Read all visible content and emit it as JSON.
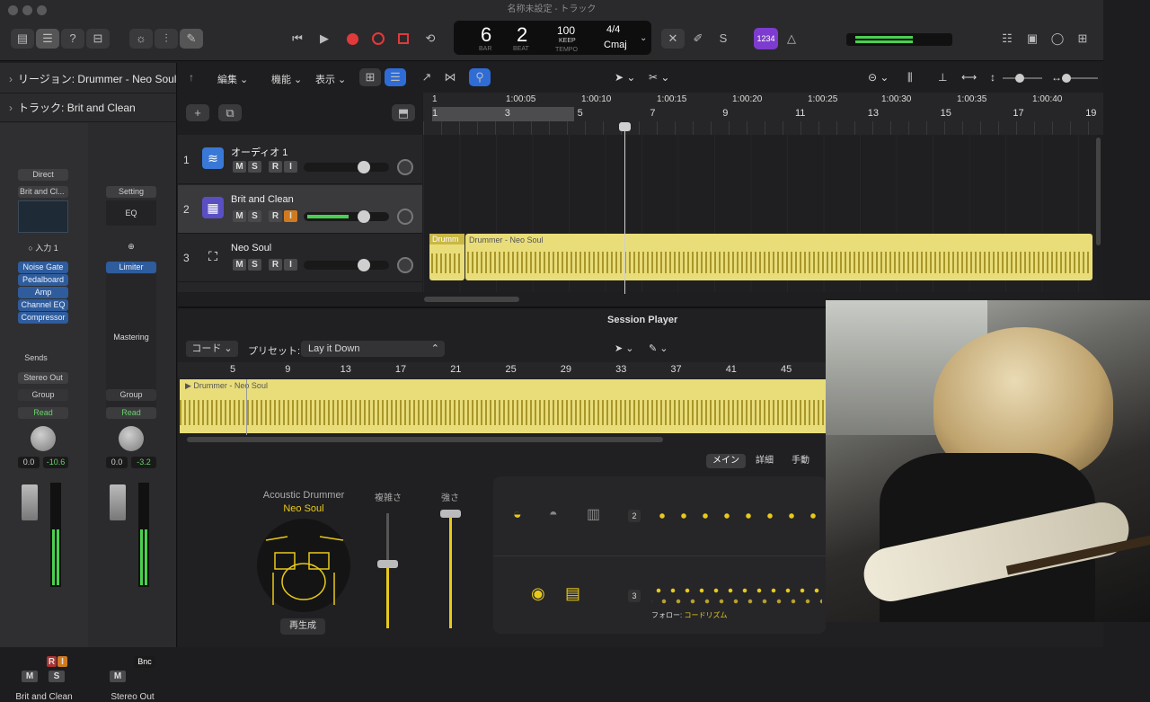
{
  "window": {
    "title": "名称未設定 - トラック"
  },
  "lcd": {
    "bar": "6",
    "beat": "2",
    "bar_label": "BAR",
    "beat_label": "BEAT",
    "tempo": "100",
    "keep": "KEEP",
    "tempo_label": "TEMPO",
    "time_sig": "4/4",
    "key": "Cmaj"
  },
  "toolbar": {
    "count_in_badge": "1234"
  },
  "inspector": {
    "region_row": "リージョン: Drummer - Neo Soul",
    "track_row_prefix": "トラック:",
    "track_row_name": "Brit and Clean",
    "strip1": {
      "top": "Direct",
      "preset": "Brit and Cl...",
      "input": "入力 1",
      "plugins": [
        "Noise Gate",
        "Pedalboard",
        "Amp",
        "Channel EQ",
        "Compressor"
      ],
      "sends": "Sends",
      "output": "Stereo Out",
      "group": "Group",
      "read": "Read",
      "vol": "0.0",
      "peak": "-10.6",
      "r": "R",
      "i": "I",
      "m": "M",
      "s": "S",
      "name": "Brit and Clean"
    },
    "strip2": {
      "setting": "Setting",
      "eq": "EQ",
      "plugins": [
        "Limiter"
      ],
      "mastering": "Mastering",
      "group": "Group",
      "read": "Read",
      "vol": "0.0",
      "peak": "-3.2",
      "bnc": "Bnc",
      "m": "M",
      "name": "Stereo Out"
    }
  },
  "tracks_bar": {
    "edit": "編集",
    "function": "機能",
    "view": "表示"
  },
  "ruler": {
    "times": [
      "1",
      "1:00:05",
      "1:00:10",
      "1:00:15",
      "1:00:20",
      "1:00:25",
      "1:00:30",
      "1:00:35",
      "1:00:40"
    ],
    "bars": [
      "1",
      "3",
      "5",
      "7",
      "9",
      "11",
      "13",
      "15",
      "17",
      "19"
    ]
  },
  "tracks": [
    {
      "num": "1",
      "name": "オーディオ 1",
      "m": "M",
      "s": "S",
      "r": "R",
      "i": "I"
    },
    {
      "num": "2",
      "name": "Brit and Clean",
      "m": "M",
      "s": "S",
      "r": "R",
      "i": "I"
    },
    {
      "num": "3",
      "name": "Neo Soul",
      "m": "M",
      "s": "S",
      "r": "R",
      "i": "I"
    }
  ],
  "regions": {
    "short": "Drumm",
    "main": "Drummer - Neo Soul"
  },
  "editor": {
    "title": "Session Player",
    "chord_menu": "コード",
    "preset_label": "プリセット:",
    "preset_value": "Lay it Down",
    "bars": [
      "5",
      "9",
      "13",
      "17",
      "21",
      "25",
      "29",
      "33",
      "37",
      "41",
      "45"
    ],
    "region_name": "Drummer - Neo Soul",
    "tabs": [
      "メイン",
      "詳細",
      "手動"
    ],
    "drummer_type": "Acoustic Drummer",
    "drummer_style": "Neo Soul",
    "complexity": "複雑さ",
    "intensity": "強さ",
    "play_button": "再生成",
    "row2_num": "2",
    "row3_num": "3",
    "follow_label": "フォロー:",
    "follow_value": "コードリズム"
  },
  "colors": {
    "accent": "#2f6cd6",
    "region": "#e9dd7a",
    "drummer_yellow": "#e8c91c",
    "count_in": "#7d3ccf"
  }
}
